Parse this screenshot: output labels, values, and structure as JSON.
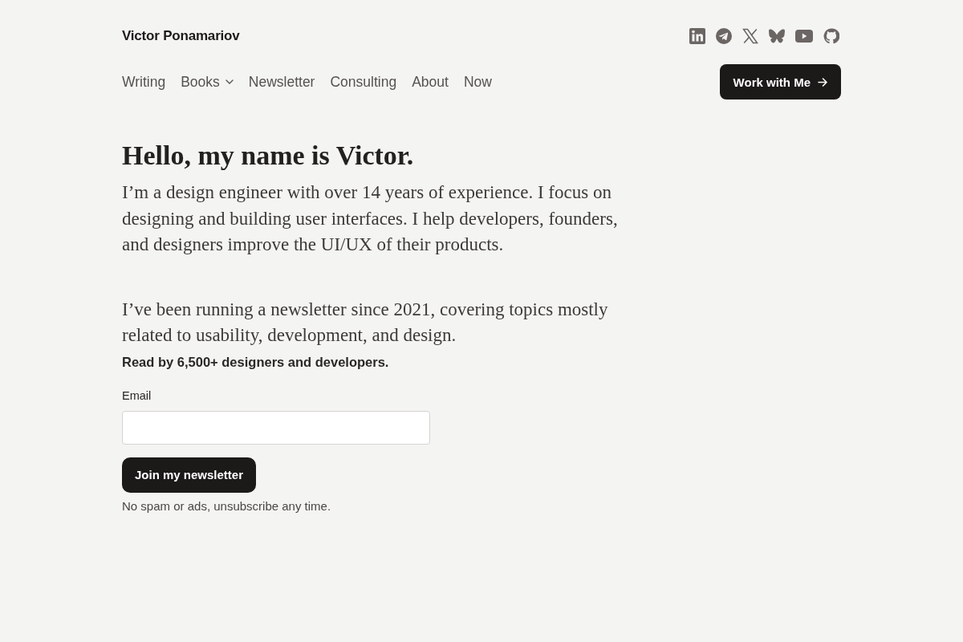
{
  "header": {
    "site_name": "Victor Ponamariov",
    "cta": "Work with Me"
  },
  "nav": [
    {
      "label": "Writing",
      "kind": "link"
    },
    {
      "label": "Books",
      "kind": "dropdown"
    },
    {
      "label": "Newsletter",
      "kind": "link"
    },
    {
      "label": "Consulting",
      "kind": "link"
    },
    {
      "label": "About",
      "kind": "link"
    },
    {
      "label": "Now",
      "kind": "link"
    }
  ],
  "intro": {
    "heading": "Hello, my name is Victor.",
    "text": "I’m a design engineer with over 14 years of experience. I focus on designing and building user interfaces. I help developers, founders, and designers improve the UI/UX of their products."
  },
  "newsletter": {
    "text": "I’ve been running a newsletter since 2021, covering topics mostly related to usability, development, and design.",
    "readers": "Read by 6,500+ designers and developers.",
    "email_label": "Email",
    "button": "Join my newsletter",
    "note": "No spam or ads, unsubscribe any time."
  }
}
